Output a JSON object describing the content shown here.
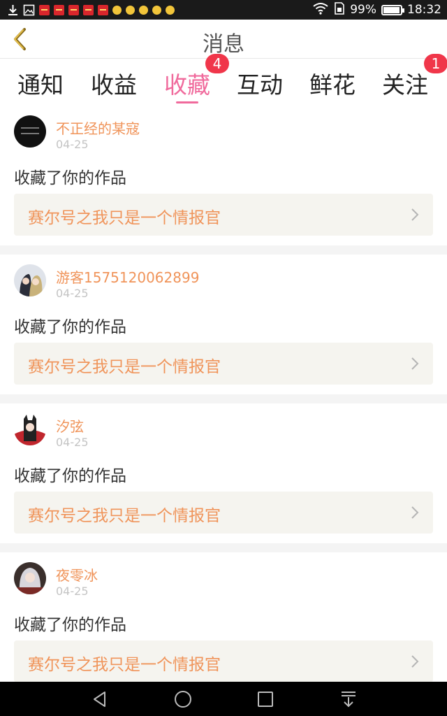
{
  "status_bar": {
    "battery": "99%",
    "time": "18:32",
    "left_icons": [
      "download-icon",
      "image-icon",
      "red-packet-icon",
      "red-packet-icon",
      "red-packet-icon",
      "red-packet-icon",
      "red-packet-icon",
      "bulb-icon",
      "bulb-icon",
      "bulb-icon",
      "bulb-icon",
      "bulb-icon"
    ]
  },
  "header": {
    "title": "消息",
    "back_icon": "chevron-left-icon"
  },
  "tabs": [
    {
      "label": "通知",
      "badge": ""
    },
    {
      "label": "收益",
      "badge": ""
    },
    {
      "label": "收藏",
      "badge": "4",
      "active": true
    },
    {
      "label": "互动",
      "badge": ""
    },
    {
      "label": "鲜花",
      "badge": ""
    },
    {
      "label": "关注",
      "badge": "1"
    }
  ],
  "colors": {
    "accent_pink": "#f06a9c",
    "name_orange": "#f0945a",
    "badge_red": "#f0364a",
    "work_box_bg": "#f5f4ef"
  },
  "messages": [
    {
      "username": "不正经的某寇",
      "date": "04-25",
      "action": "收藏了你的作品",
      "work_title": "赛尔号之我只是一个情报官"
    },
    {
      "username": "游客1575120062899",
      "date": "04-25",
      "action": "收藏了你的作品",
      "work_title": "赛尔号之我只是一个情报官"
    },
    {
      "username": "汐弦",
      "date": "04-25",
      "action": "收藏了你的作品",
      "work_title": "赛尔号之我只是一个情报官"
    },
    {
      "username": "夜零冰",
      "date": "04-25",
      "action": "收藏了你的作品",
      "work_title": "赛尔号之我只是一个情报官"
    }
  ],
  "nav_bar": {
    "icons": [
      "back-triangle-icon",
      "home-circle-icon",
      "recents-square-icon",
      "notification-pull-down-icon"
    ]
  }
}
